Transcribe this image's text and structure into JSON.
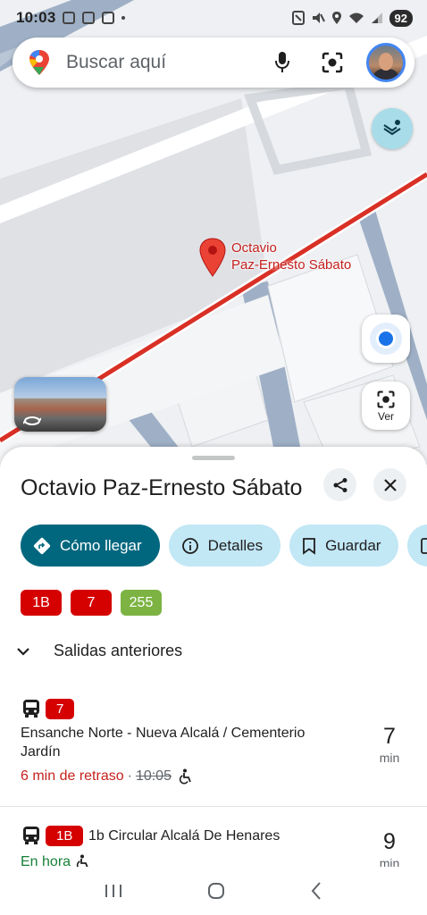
{
  "status_bar": {
    "time": "10:03",
    "battery": "92",
    "icons": [
      "screenshot-icon",
      "photo-icon",
      "calendar-icon",
      "nfc-icon",
      "mute-icon",
      "location-icon",
      "wifi-icon",
      "signal-icon"
    ]
  },
  "search": {
    "placeholder": "Buscar aquí",
    "icons": [
      "maps-pin-icon",
      "mic-icon",
      "lens-icon",
      "avatar"
    ]
  },
  "map": {
    "marker_label_line1": "Octavio",
    "marker_label_line2": "Paz-Ernesto Sábato",
    "lens_button_label": "Ver",
    "route_color": "#d93025"
  },
  "place": {
    "title": "Octavio Paz-Ernesto Sábato",
    "chips": [
      {
        "label": "Cómo llegar",
        "icon": "directions-icon"
      },
      {
        "label": "Detalles",
        "icon": "info-icon"
      },
      {
        "label": "Guardar",
        "icon": "bookmark-icon"
      }
    ],
    "routes": [
      {
        "label": "1B",
        "color": "#d50000"
      },
      {
        "label": "7",
        "color": "#d50000"
      },
      {
        "label": "255",
        "color": "#7cb342"
      }
    ],
    "previous_departures_label": "Salidas anteriores"
  },
  "departures": [
    {
      "line": "7",
      "line_color": "#d50000",
      "destination": "Ensanche Norte - Nueva Alcalá / Cementerio Jardín",
      "status": "6 min de retraso",
      "separator": "·",
      "scheduled": "10:05",
      "status_color": "#c5221f",
      "minutes": "7",
      "unit": "min"
    },
    {
      "line": "1B",
      "line_color": "#d50000",
      "destination": "1b Circular Alcalá De Henares",
      "status": "En hora",
      "status_color": "#188038",
      "minutes": "9",
      "unit": "min"
    }
  ],
  "nav": [
    "recents-icon",
    "home-icon",
    "back-icon"
  ]
}
